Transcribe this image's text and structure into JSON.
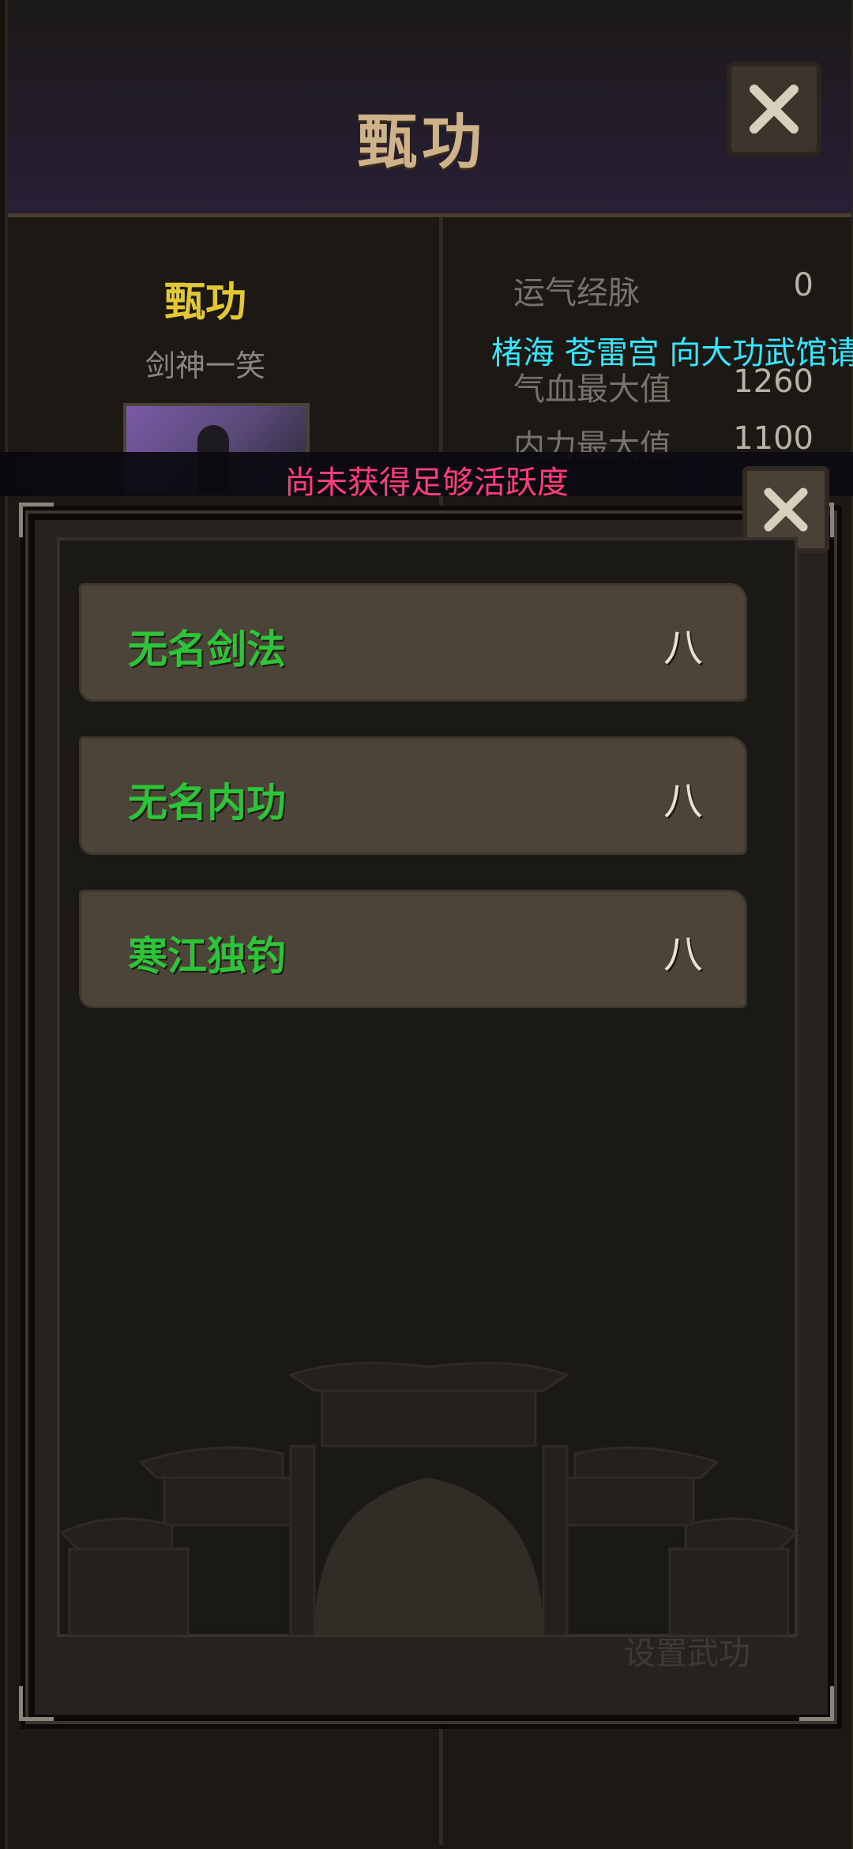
{
  "window": {
    "title": "甄功",
    "close_icon": "close-icon"
  },
  "character": {
    "name": "甄功",
    "title": "剑神一笑"
  },
  "stats": [
    {
      "label": "运气经脉",
      "value": "0"
    },
    {
      "label": "气血最大值",
      "value": "1260"
    },
    {
      "label": "内力最大值",
      "value": "1100"
    }
  ],
  "notices": {
    "broadcast": "楮海 苍雷宫 向大功武馆请教",
    "warning": "尚未获得足够活跃度"
  },
  "skills_panel": {
    "items": [
      {
        "name": "无名剑法",
        "level": "八"
      },
      {
        "name": "无名内功",
        "level": "八"
      },
      {
        "name": "寒江独钓",
        "level": "八"
      }
    ]
  },
  "footer": {
    "set_martial": "设置武功"
  },
  "colors": {
    "skill_name": "#2ec43a",
    "broadcast": "#36e6ff",
    "warning": "#ff3d7a",
    "char_name": "#e3c836"
  }
}
